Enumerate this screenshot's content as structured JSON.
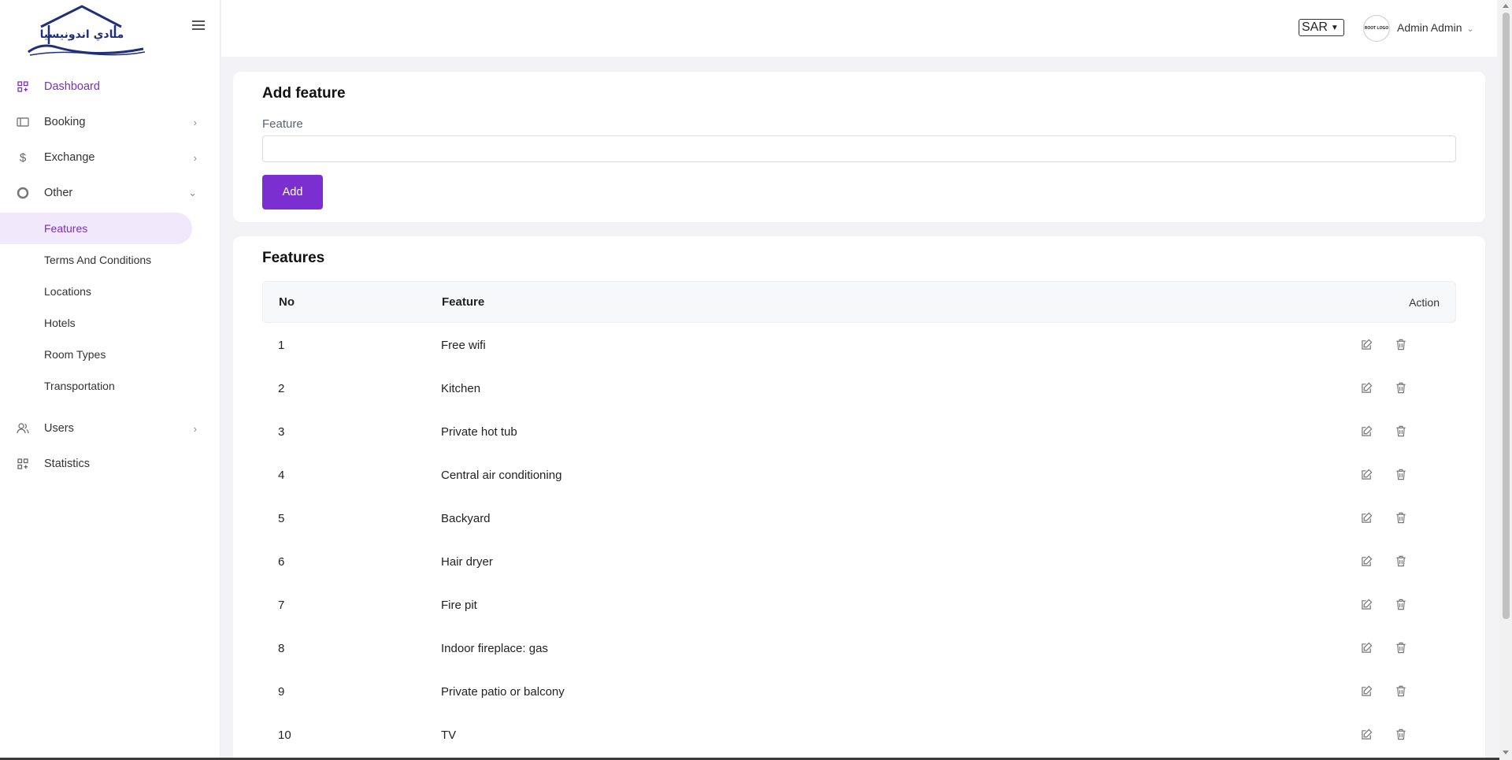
{
  "sidebar": {
    "logo_text": "مـادي اندونيسيا",
    "items": [
      {
        "label": "Dashboard",
        "icon": "dashboard-icon",
        "active": true
      },
      {
        "label": "Booking",
        "icon": "ticket-icon"
      },
      {
        "label": "Exchange",
        "icon": "dollar-icon"
      },
      {
        "label": "Other",
        "icon": "circle-icon",
        "expanded": true
      },
      {
        "label": "Users",
        "icon": "users-icon"
      },
      {
        "label": "Statistics",
        "icon": "statistics-icon"
      }
    ],
    "sub_items": [
      {
        "label": "Features",
        "active": true
      },
      {
        "label": "Terms And Conditions"
      },
      {
        "label": "Locations"
      },
      {
        "label": "Hotels"
      },
      {
        "label": "Room Types"
      },
      {
        "label": "Transportation"
      }
    ]
  },
  "header": {
    "currency": "SAR",
    "avatar_text": "ROOT LOGO",
    "user_name": "Admin Admin"
  },
  "add_form": {
    "title": "Add feature",
    "field_label": "Feature",
    "field_value": "",
    "button_label": "Add"
  },
  "table": {
    "title": "Features",
    "columns": {
      "no": "No",
      "feature": "Feature",
      "action": "Action"
    },
    "rows": [
      {
        "no": "1",
        "feature": "Free wifi"
      },
      {
        "no": "2",
        "feature": "Kitchen"
      },
      {
        "no": "3",
        "feature": "Private hot tub"
      },
      {
        "no": "4",
        "feature": "Central air conditioning"
      },
      {
        "no": "5",
        "feature": "Backyard"
      },
      {
        "no": "6",
        "feature": "Hair dryer"
      },
      {
        "no": "7",
        "feature": "Fire pit"
      },
      {
        "no": "8",
        "feature": "Indoor fireplace: gas"
      },
      {
        "no": "9",
        "feature": "Private patio or balcony"
      },
      {
        "no": "10",
        "feature": "TV"
      }
    ]
  },
  "colors": {
    "accent": "#7b2fd0",
    "active_bg": "#f1e8fb",
    "logo_blue": "#1f2f7a"
  }
}
